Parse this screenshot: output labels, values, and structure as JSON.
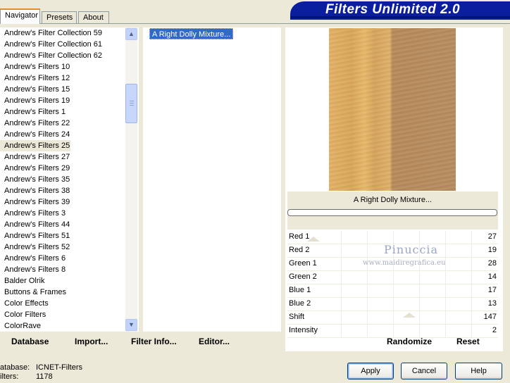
{
  "tabs": [
    {
      "label": "Navigator"
    },
    {
      "label": "Presets"
    },
    {
      "label": "About"
    }
  ],
  "app_title": "Filters Unlimited 2.0",
  "categories": [
    {
      "label": "Andrew's Filter Collection 59"
    },
    {
      "label": "Andrew's Filter Collection 61"
    },
    {
      "label": "Andrew's Filter Collection 62"
    },
    {
      "label": "Andrew's Filters 10"
    },
    {
      "label": "Andrew's Filters 12"
    },
    {
      "label": "Andrew's Filters 15"
    },
    {
      "label": "Andrew's Filters 19"
    },
    {
      "label": "Andrew's Filters 1"
    },
    {
      "label": "Andrew's Filters 22"
    },
    {
      "label": "Andrew's Filters 24"
    },
    {
      "label": "Andrew's Filters 25",
      "selected": true
    },
    {
      "label": "Andrew's Filters 27"
    },
    {
      "label": "Andrew's Filters 29"
    },
    {
      "label": "Andrew's Filters 35"
    },
    {
      "label": "Andrew's Filters 38"
    },
    {
      "label": "Andrew's Filters 39"
    },
    {
      "label": "Andrew's Filters 3"
    },
    {
      "label": "Andrew's Filters 44"
    },
    {
      "label": "Andrew's Filters 51"
    },
    {
      "label": "Andrew's Filters 52"
    },
    {
      "label": "Andrew's Filters 6"
    },
    {
      "label": "Andrew's Filters 8"
    },
    {
      "label": "Balder Olrik"
    },
    {
      "label": "Buttons & Frames"
    },
    {
      "label": "Color Effects"
    },
    {
      "label": "Color Filters"
    },
    {
      "label": "ColorRave"
    }
  ],
  "filters": [
    {
      "label": "A Right Dolly Mixture..."
    }
  ],
  "preview": {
    "filter_name": "A Right Dolly Mixture..."
  },
  "parameters": [
    {
      "label": "Red 1",
      "value": "27"
    },
    {
      "label": "Red 2",
      "value": "19"
    },
    {
      "label": "Green 1",
      "value": "28"
    },
    {
      "label": "Green 2",
      "value": "14"
    },
    {
      "label": "Blue 1",
      "value": "17"
    },
    {
      "label": "Blue 2",
      "value": "13"
    },
    {
      "label": "Shift",
      "value": "147"
    },
    {
      "label": "Intensity",
      "value": "2"
    }
  ],
  "watermark": {
    "name": "Pinuccia",
    "site": "www.maidiregrafica.eu"
  },
  "commands": {
    "database": "Database",
    "import": "Import...",
    "filter_info": "Filter Info...",
    "editor": "Editor...",
    "randomize": "Randomize",
    "reset": "Reset"
  },
  "status": {
    "database_label": "atabase:",
    "database_value": "ICNET-Filters",
    "filters_label": "ilters:",
    "filters_value": "1178"
  },
  "buttons": {
    "apply": "Apply",
    "cancel": "Cancel",
    "help": "Help"
  },
  "colors": {
    "banner": "#0a1e9e",
    "selection": "#316ac5",
    "window_bg": "#ece9d8"
  }
}
